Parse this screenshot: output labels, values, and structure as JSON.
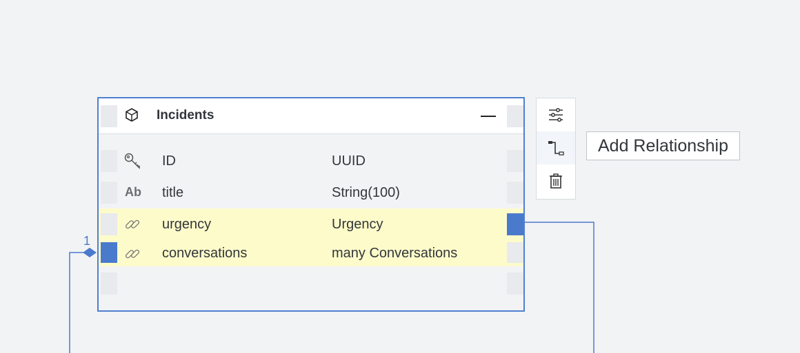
{
  "entity": {
    "title": "Incidents",
    "collapse_label": "—",
    "fields": [
      {
        "icon": "key-icon",
        "name": "ID",
        "type": "UUID",
        "highlighted": false
      },
      {
        "icon": "text-type-icon",
        "icon_text": "Ab",
        "name": "title",
        "type": "String(100)",
        "highlighted": false
      },
      {
        "icon": "link-icon",
        "name": "urgency",
        "type": "Urgency",
        "highlighted": true
      },
      {
        "icon": "link-icon",
        "name": "conversations",
        "type": "many Conversations",
        "highlighted": true
      }
    ]
  },
  "toolbar": {
    "items": [
      {
        "icon": "sliders-icon",
        "label": "Properties"
      },
      {
        "icon": "relationship-icon",
        "label": "Add Relationship",
        "active": true
      },
      {
        "icon": "trash-icon",
        "label": "Delete"
      }
    ]
  },
  "tooltip": {
    "text": "Add Relationship"
  },
  "connector": {
    "multiplicity": "1"
  },
  "colors": {
    "accent": "#4a7acc",
    "highlight_row": "#fdfbca",
    "canvas": "#f2f3f5"
  }
}
